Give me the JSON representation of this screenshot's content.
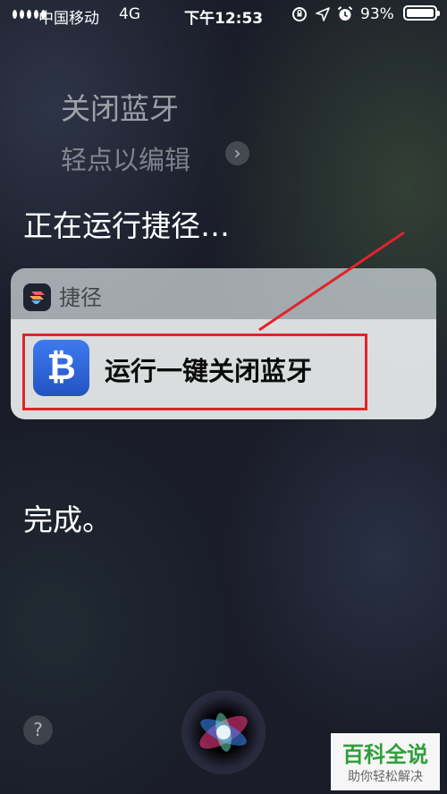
{
  "status_bar": {
    "carrier": "中国移动",
    "network": "4G",
    "time": "下午12:53",
    "battery_percent": "93%",
    "battery_level": 0.93,
    "icons": [
      "signal-dots-icon",
      "orientation-lock-icon",
      "location-arrow-icon",
      "alarm-clock-icon",
      "battery-icon"
    ]
  },
  "siri": {
    "request_text": "关闭蓝牙",
    "tap_to_edit": "轻点以编辑",
    "running_text": "正在运行捷径…",
    "done_text": "完成。"
  },
  "shortcut_card": {
    "app_name": "捷径",
    "action_label": "运行一键关闭蓝牙",
    "action_glyph": "₿",
    "action_icon_color": "#2f66dc"
  },
  "bottom": {
    "help_glyph": "?"
  },
  "watermark": {
    "title": "百科全说",
    "subtitle": "助你轻松解决"
  },
  "annotation_color": "#e0242b"
}
